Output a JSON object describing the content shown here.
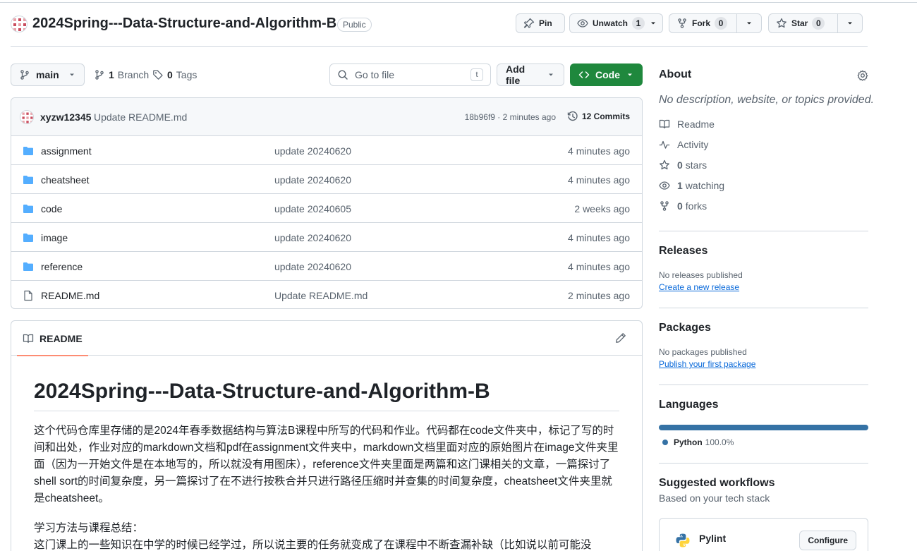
{
  "repo": {
    "name": "2024Spring---Data-Structure-and-Algorithm-B",
    "visibility": "Public"
  },
  "header_actions": {
    "pin_label": "Pin",
    "unwatch_label": "Unwatch",
    "unwatch_count": "1",
    "fork_label": "Fork",
    "fork_count": "0",
    "star_label": "Star",
    "star_count": "0"
  },
  "toolbar": {
    "branch": "main",
    "branches_count": "1",
    "branches_label": "Branch",
    "tags_count": "0",
    "tags_label": "Tags",
    "goto_placeholder": "Go to file",
    "goto_shortcut": "t",
    "add_file_label": "Add file",
    "code_label": "Code"
  },
  "latest_commit": {
    "author": "xyzw12345",
    "message": "Update README.md",
    "sha_time": "18b96f9 · 2 minutes ago",
    "commits_label": "12 Commits"
  },
  "files": [
    {
      "name": "assignment",
      "type": "folder",
      "message": "update 20240620",
      "time": "4 minutes ago"
    },
    {
      "name": "cheatsheet",
      "type": "folder",
      "message": "update 20240620",
      "time": "4 minutes ago"
    },
    {
      "name": "code",
      "type": "folder",
      "message": "update 20240605",
      "time": "2 weeks ago"
    },
    {
      "name": "image",
      "type": "folder",
      "message": "update 20240620",
      "time": "4 minutes ago"
    },
    {
      "name": "reference",
      "type": "folder",
      "message": "update 20240620",
      "time": "4 minutes ago"
    },
    {
      "name": "README.md",
      "type": "file",
      "message": "Update README.md",
      "time": "2 minutes ago"
    }
  ],
  "readme": {
    "tab_label": "README",
    "heading": "2024Spring---Data-Structure-and-Algorithm-B",
    "paragraph": "这个代码仓库里存储的是2024年春季数据结构与算法B课程中所写的代码和作业。代码都在code文件夹中，标记了写的时间和出处，作业对应的markdown文档和pdf在assignment文件夹中，markdown文档里面对应的原始图片在image文件夹里面（因为一开始文件是在本地写的，所以就没有用图床），reference文件夹里面是两篇和这门课相关的文章，一篇探讨了shell sort的时间复杂度，另一篇探讨了在不进行按秩合并只进行路径压缩时并查集的时间复杂度，cheatsheet文件夹里就是cheatsheet。",
    "summary_title": "学习方法与课程总结：",
    "summary_line": "这门课上的一些知识在中学的时候已经学过，所以说主要的任务就变成了在课程中不断查漏补缺（比如说以前可能没"
  },
  "sidebar": {
    "about_title": "About",
    "about_desc": "No description, website, or topics provided.",
    "stats": [
      {
        "icon": "book-icon",
        "count": "",
        "label": "Readme"
      },
      {
        "icon": "pulse-icon",
        "count": "",
        "label": "Activity"
      },
      {
        "icon": "star-icon",
        "count": "0",
        "label": "stars"
      },
      {
        "icon": "eye-icon",
        "count": "1",
        "label": "watching"
      },
      {
        "icon": "fork-icon",
        "count": "0",
        "label": "forks"
      }
    ],
    "releases_title": "Releases",
    "releases_none": "No releases published",
    "releases_link": "Create a new release",
    "packages_title": "Packages",
    "packages_none": "No packages published",
    "packages_link": "Publish your first package",
    "languages_title": "Languages",
    "language_name": "Python",
    "language_pct": "100.0%",
    "workflows_title": "Suggested workflows",
    "workflows_sub": "Based on your tech stack",
    "workflow_name": "Pylint",
    "workflow_btn": "Configure"
  },
  "colors": {
    "accent_green": "#1f883d",
    "link_blue": "#0969da",
    "folder_blue": "#54aeff",
    "python": "#3572a5",
    "tab_underline": "#fd8c73"
  }
}
